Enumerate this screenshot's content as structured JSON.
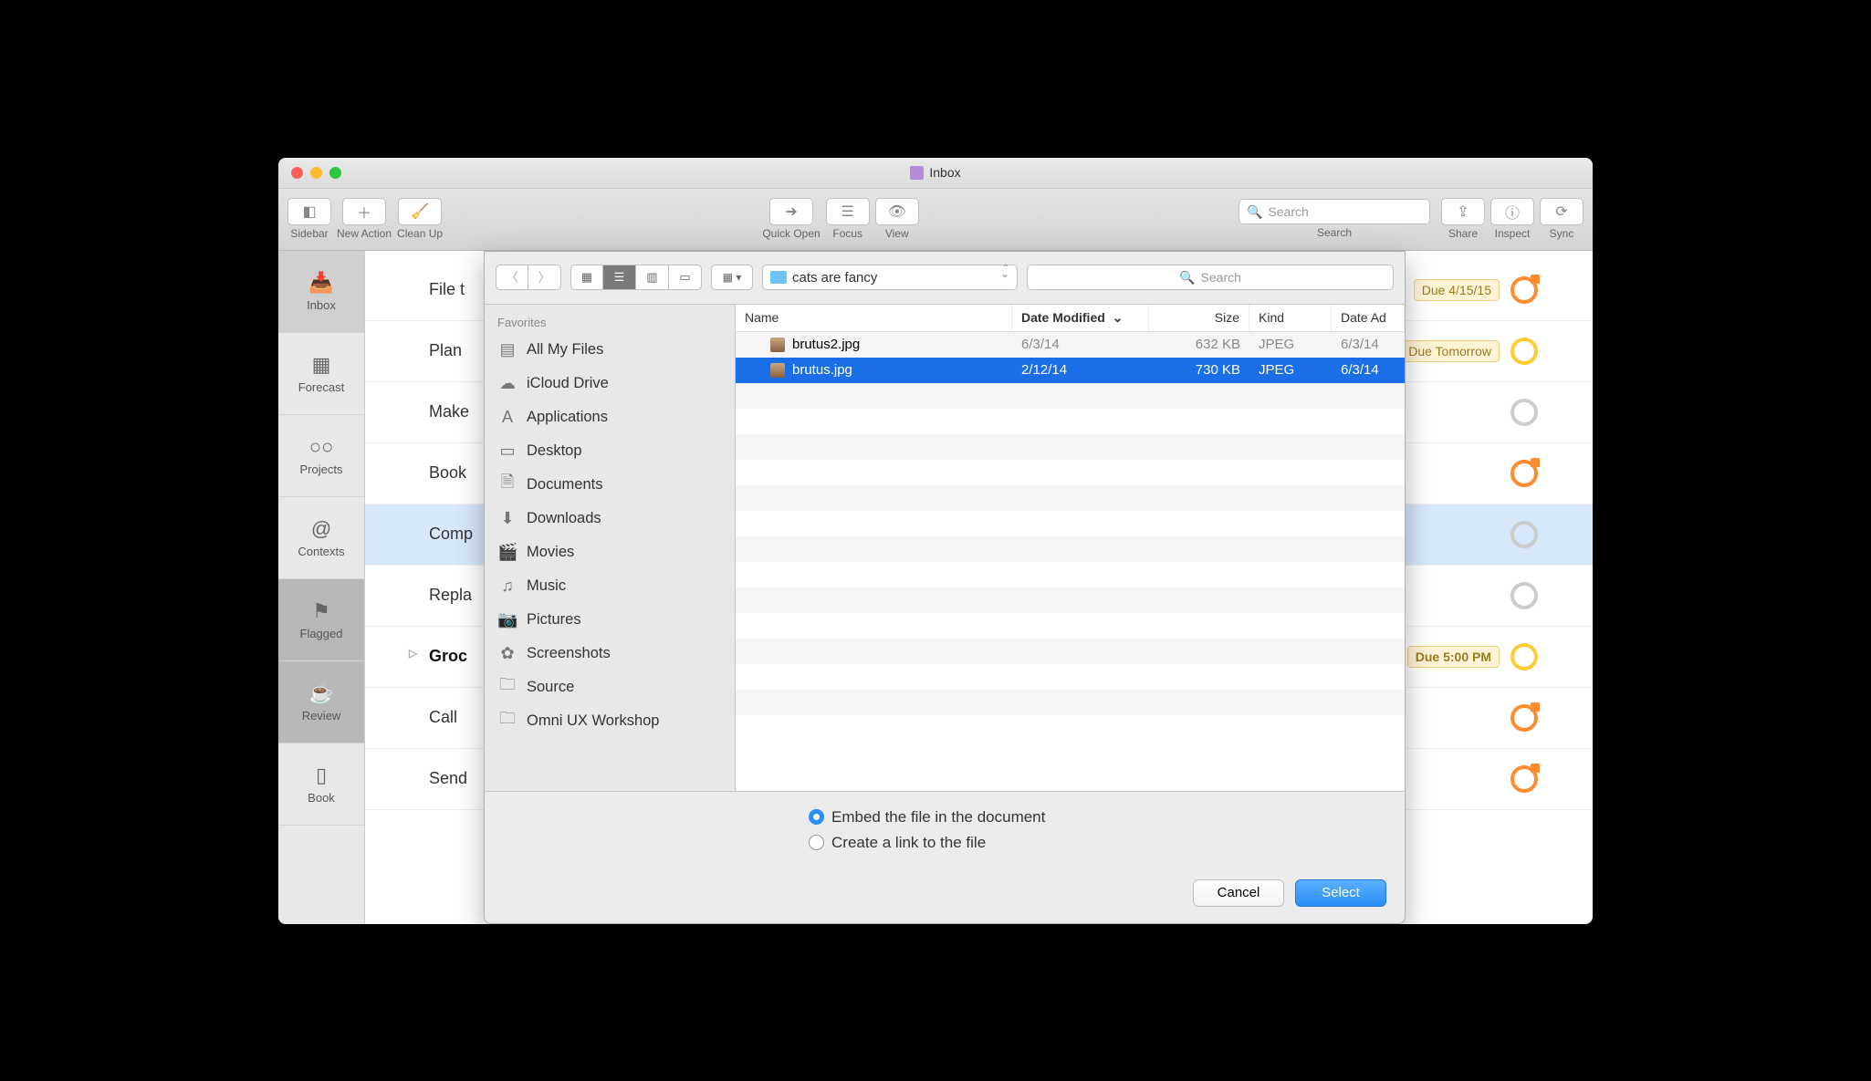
{
  "window": {
    "title": "Inbox"
  },
  "toolbar": {
    "left": [
      {
        "label": "Sidebar",
        "glyph": "◧"
      },
      {
        "label": "New Action",
        "glyph": "＋"
      },
      {
        "label": "Clean Up",
        "glyph": "🧹"
      }
    ],
    "center": [
      {
        "label": "Quick Open",
        "glyph": "➜"
      },
      {
        "label": "Focus",
        "glyph": "☰"
      },
      {
        "label": "View",
        "glyph": "👁"
      }
    ],
    "search_placeholder": "Search",
    "search_label": "Search",
    "right": [
      {
        "label": "Share",
        "glyph": "⇪"
      },
      {
        "label": "Inspect",
        "glyph": "ⓘ"
      },
      {
        "label": "Sync",
        "glyph": "⟳"
      }
    ]
  },
  "sidebar_tabs": [
    {
      "label": "Inbox",
      "glyph": "📥",
      "active": true
    },
    {
      "label": "Forecast",
      "glyph": "▦"
    },
    {
      "label": "Projects",
      "glyph": "○○"
    },
    {
      "label": "Contexts",
      "glyph": "@"
    },
    {
      "label": "Flagged",
      "glyph": "⚑"
    },
    {
      "label": "Review",
      "glyph": "☕"
    },
    {
      "label": "Book",
      "glyph": "▯"
    }
  ],
  "tasks": [
    {
      "title": "File t",
      "due": "Due 4/15/15",
      "circle": "orange-flag"
    },
    {
      "title": "Plan",
      "due": "Due Tomorrow",
      "circle": "yellow"
    },
    {
      "title": "Make",
      "circle": "gray"
    },
    {
      "title": "Book",
      "circle": "orange-flag"
    },
    {
      "title": "Comp",
      "circle": "gray",
      "selected": true
    },
    {
      "title": "Repla",
      "circle": "gray"
    },
    {
      "title": "Groc",
      "due": "Due 5:00 PM",
      "circle": "yellow",
      "bold": true,
      "disclosure": true
    },
    {
      "title": "Call",
      "circle": "orange-flag"
    },
    {
      "title": "Send",
      "circle": "orange-flag"
    }
  ],
  "sheet": {
    "folder_name": "cats are fancy",
    "search_placeholder": "Search",
    "favorites_header": "Favorites",
    "favorites": [
      {
        "label": "All My Files",
        "glyph": "▤"
      },
      {
        "label": "iCloud Drive",
        "glyph": "☁"
      },
      {
        "label": "Applications",
        "glyph": "A"
      },
      {
        "label": "Desktop",
        "glyph": "▭"
      },
      {
        "label": "Documents",
        "glyph": "🗎"
      },
      {
        "label": "Downloads",
        "glyph": "⬇"
      },
      {
        "label": "Movies",
        "glyph": "🎬"
      },
      {
        "label": "Music",
        "glyph": "♫"
      },
      {
        "label": "Pictures",
        "glyph": "📷"
      },
      {
        "label": "Screenshots",
        "glyph": "✿"
      },
      {
        "label": "Source",
        "glyph": "🗀"
      },
      {
        "label": "Omni UX Workshop",
        "glyph": "🗀"
      }
    ],
    "columns": {
      "name": "Name",
      "date_modified": "Date Modified",
      "size": "Size",
      "kind": "Kind",
      "date_added": "Date Ad"
    },
    "sort_indicator": "⌄",
    "files": [
      {
        "name": "brutus2.jpg",
        "date_modified": "6/3/14",
        "size": "632 KB",
        "kind": "JPEG",
        "date_added": "6/3/14",
        "selected": false
      },
      {
        "name": "brutus.jpg",
        "date_modified": "2/12/14",
        "size": "730 KB",
        "kind": "JPEG",
        "date_added": "6/3/14",
        "selected": true
      }
    ],
    "options": {
      "embed_label": "Embed the file in the document",
      "link_label": "Create a link to the file",
      "selected": "embed"
    },
    "buttons": {
      "cancel": "Cancel",
      "select": "Select"
    }
  }
}
